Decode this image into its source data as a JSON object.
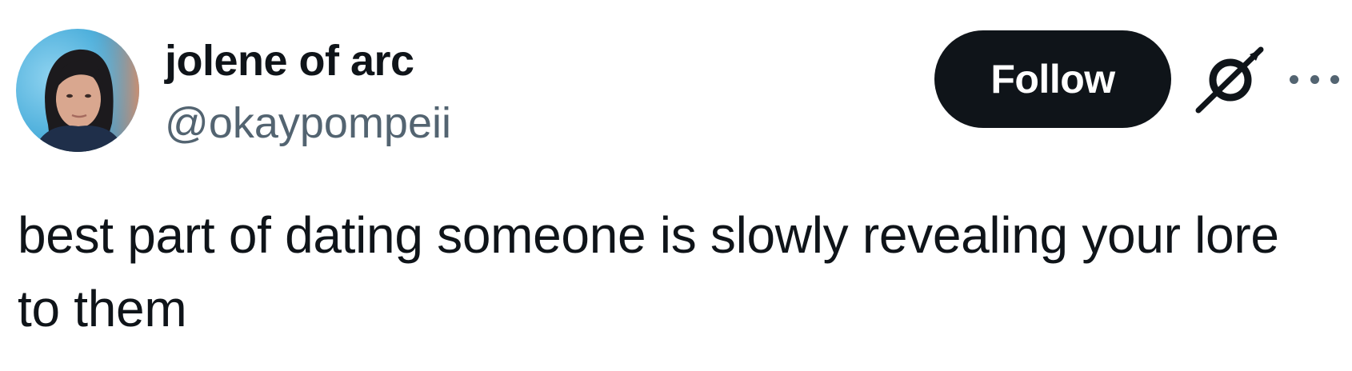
{
  "author": {
    "display_name": "jolene of arc",
    "handle": "@okaypompeii"
  },
  "actions": {
    "follow_label": "Follow",
    "grok_icon": "grok-slash-icon",
    "more_icon": "more-horizontal-icon"
  },
  "tweet": {
    "text": "best part of dating someone is slowly revealing your lore to them"
  },
  "colors": {
    "text_primary": "#0f1419",
    "text_secondary": "#536471",
    "button_bg": "#0f1419",
    "button_text": "#ffffff",
    "background": "#ffffff"
  }
}
